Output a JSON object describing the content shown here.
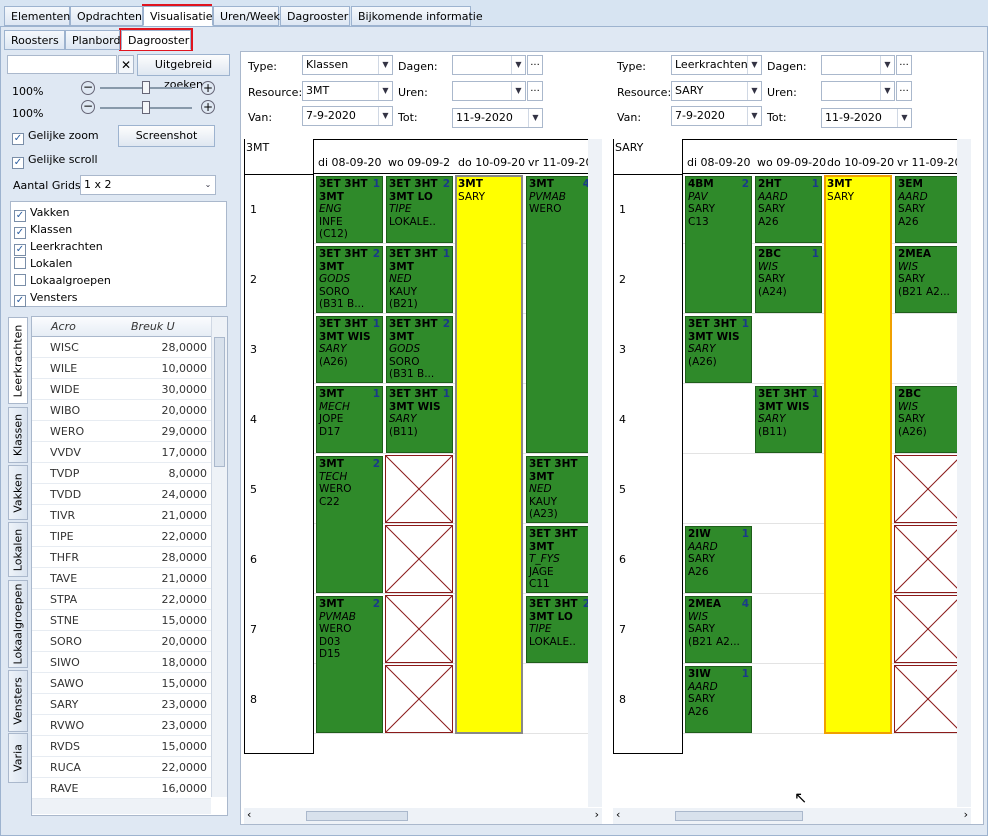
{
  "top_tabs": [
    "Elementen",
    "Opdrachten",
    "Visualisatie",
    "Uren/Week",
    "Dagrooster",
    "Bijkomende informatie"
  ],
  "sub_tabs": [
    "Roosters",
    "Planbord",
    "Dagrooster"
  ],
  "left": {
    "search_placeholder": "",
    "clear_icon": "✕",
    "advanced_search": "Uitgebreid zoeken",
    "zoom1": "100%",
    "zoom2": "100%",
    "minus": "−",
    "plus": "+",
    "gelijke_zoom": "Gelijke zoom",
    "screenshot": "Screenshot",
    "gelijke_scroll": "Gelijke scroll",
    "aantal_grids_label": "Aantal Grids",
    "aantal_grids_value": "1 x 2",
    "checks": [
      {
        "label": "Vakken",
        "checked": true
      },
      {
        "label": "Klassen",
        "checked": true
      },
      {
        "label": "Leerkrachten",
        "checked": true
      },
      {
        "label": "Lokalen",
        "checked": false
      },
      {
        "label": "Lokaalgroepen",
        "checked": false
      },
      {
        "label": "Vensters",
        "checked": true
      }
    ],
    "vtabs": [
      "Leerkrachten",
      "Klassen",
      "Vakken",
      "Lokalen",
      "Lokaalgroepen",
      "Vensters",
      "Varia"
    ],
    "col_acro": "Acro",
    "col_breuk": "Breuk U",
    "rows": [
      [
        "WISC",
        "28,0000"
      ],
      [
        "WILE",
        "10,0000"
      ],
      [
        "WIDE",
        "30,0000"
      ],
      [
        "WIBO",
        "20,0000"
      ],
      [
        "WERO",
        "29,0000"
      ],
      [
        "VVDV",
        "17,0000"
      ],
      [
        "TVDP",
        "8,0000"
      ],
      [
        "TVDD",
        "24,0000"
      ],
      [
        "TIVR",
        "21,0000"
      ],
      [
        "TIPE",
        "22,0000"
      ],
      [
        "THFR",
        "28,0000"
      ],
      [
        "TAVE",
        "21,0000"
      ],
      [
        "STPA",
        "22,0000"
      ],
      [
        "STNE",
        "15,0000"
      ],
      [
        "SORO",
        "20,0000"
      ],
      [
        "SIWO",
        "18,0000"
      ],
      [
        "SAWO",
        "15,0000"
      ],
      [
        "SARY",
        "23,0000"
      ],
      [
        "RVWO",
        "23,0000"
      ],
      [
        "RVDS",
        "15,0000"
      ],
      [
        "RUCA",
        "22,0000"
      ],
      [
        "RAVE",
        "16,0000"
      ]
    ]
  },
  "grid1": {
    "type_label": "Type:",
    "type_value": "Klassen",
    "resource_label": "Resource:",
    "resource_value": "3MT",
    "van_label": "Van:",
    "van_value": "7-9-2020",
    "dagen_label": "Dagen:",
    "uren_label": "Uren:",
    "tot_label": "Tot:",
    "tot_value": "11-9-2020",
    "corner": "3MT",
    "days": [
      "di 08-09-20",
      "wo 09-09-2",
      "do 10-09-20",
      "vr 11-09-20"
    ],
    "rows": [
      "1",
      "2",
      "3",
      "4",
      "5",
      "6",
      "7",
      "8"
    ],
    "cells": [
      [
        "3ET  3HT|1",
        "3MT",
        "ENG",
        "INFE",
        "(C12)"
      ],
      [
        "3ET  3HT|2",
        "3MT  LO",
        "TIPE",
        "LOKALE..",
        ""
      ],
      [
        "3MT",
        "SARY",
        "",
        "",
        ""
      ],
      [
        "3MT|4",
        "PVMAB",
        "WERO",
        "",
        ""
      ],
      [
        "3ET  3HT|2",
        "3MT",
        "GODS",
        "SORO",
        "(B31 B..."
      ],
      [
        "3ET  3HT|1",
        "3MT",
        "NED",
        "KAUY",
        "(B21)"
      ],
      [
        "3ET  3HT|1",
        "3MT  WIS",
        "SARY",
        "(A26)",
        ""
      ],
      [
        "3ET  3HT|2",
        "3MT",
        "GODS",
        "SORO",
        "(B31 B..."
      ],
      [
        "3MT|1",
        "MECH",
        "JOPE",
        "D17",
        ""
      ],
      [
        "3ET  3HT|1",
        "3MT  WIS",
        "SARY",
        "(B11)",
        ""
      ],
      [
        "3MT|2",
        "TECH",
        "WERO",
        "C22",
        ""
      ],
      [
        "3ET  3HT",
        "3MT",
        "NED",
        "KAUY",
        "(A23)"
      ],
      [
        "3ET  3HT",
        "3MT",
        "T_FYS",
        "JAGE",
        "C11"
      ],
      [
        "3MT|2",
        "PVMAB",
        "WERO",
        "D03",
        "D15"
      ],
      [
        "3ET  3HT|2",
        "3MT  LO",
        "TIPE",
        "LOKALE..",
        ""
      ]
    ]
  },
  "grid2": {
    "type_label": "Type:",
    "type_value": "Leerkrachten",
    "resource_label": "Resource:",
    "resource_value": "SARY",
    "van_label": "Van:",
    "van_value": "7-9-2020",
    "dagen_label": "Dagen:",
    "uren_label": "Uren:",
    "tot_label": "Tot:",
    "tot_value": "11-9-2020",
    "corner": "SARY",
    "days": [
      "di 08-09-20",
      "wo 09-09-20",
      "do 10-09-20",
      "vr 11-09-20"
    ],
    "rows": [
      "1",
      "2",
      "3",
      "4",
      "5",
      "6",
      "7",
      "8"
    ],
    "cells": [
      [
        "4BM|2",
        "PAV",
        "SARY",
        "C13",
        ""
      ],
      [
        "2HT|1",
        "AARD",
        "SARY",
        "A26",
        ""
      ],
      [
        "3MT",
        "SARY",
        "",
        "",
        ""
      ],
      [
        "3EM",
        "AARD",
        "SARY",
        "A26",
        ""
      ],
      [
        "2BC|1",
        "WIS",
        "SARY",
        "(A24)",
        ""
      ],
      [
        "2MEA",
        "WIS",
        "SARY",
        "(B21 A2...",
        ""
      ],
      [
        "3ET  3HT|1",
        "3MT  WIS",
        "SARY",
        "(A26)",
        ""
      ],
      [
        "3ET  3HT|1",
        "3MT  WIS",
        "SARY",
        "(B11)",
        ""
      ],
      [
        "2BC",
        "WIS",
        "SARY",
        "(A26)",
        ""
      ],
      [
        "2IW|1",
        "AARD",
        "SARY",
        "A26",
        ""
      ],
      [
        "2MEA|4",
        "WIS",
        "SARY",
        "(B21 A2...",
        ""
      ],
      [
        "3IW|1",
        "AARD",
        "SARY",
        "A26",
        ""
      ]
    ]
  },
  "colors": {
    "green": "#2f8a2a",
    "yellow": "#ffff00",
    "accent_red": "#e0141e"
  }
}
